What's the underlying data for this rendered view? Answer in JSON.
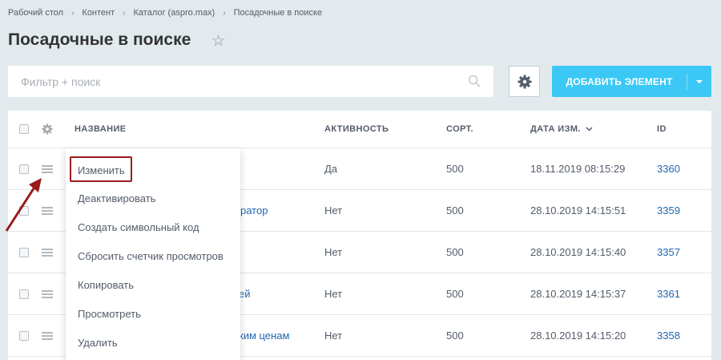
{
  "breadcrumb": [
    "Рабочий стол",
    "Контент",
    "Каталог (aspro.max)",
    "Посадочные в поиске"
  ],
  "page_title": "Посадочные в поиске",
  "filter": {
    "placeholder": "Фильтр + поиск"
  },
  "add_button_label": "ДОБАВИТЬ ЭЛЕМЕНТ",
  "columns": {
    "name": "НАЗВАНИЕ",
    "active": "АКТИВНОСТЬ",
    "sort": "СОРТ.",
    "date": "ДАТА ИЗМ.",
    "id": "ID"
  },
  "rows": [
    {
      "name": "",
      "active": "Да",
      "sort": "500",
      "date": "18.11.2019 08:15:29",
      "id": "3360"
    },
    {
      "name": "ратор",
      "active": "Нет",
      "sort": "500",
      "date": "28.10.2019 14:15:51",
      "id": "3359"
    },
    {
      "name": "",
      "active": "Нет",
      "sort": "500",
      "date": "28.10.2019 14:15:40",
      "id": "3357"
    },
    {
      "name": "ей",
      "active": "Нет",
      "sort": "500",
      "date": "28.10.2019 14:15:37",
      "id": "3361"
    },
    {
      "name": "ким ценам",
      "active": "Нет",
      "sort": "500",
      "date": "28.10.2019 14:15:20",
      "id": "3358"
    }
  ],
  "context_menu": [
    "Изменить",
    "Деактивировать",
    "Создать символьный код",
    "Сбросить счетчик просмотров",
    "Копировать",
    "Просмотреть",
    "Удалить"
  ],
  "colors": {
    "accent": "#3bc8f5",
    "link": "#2067b0",
    "highlight": "#9b1c1c",
    "background": "#e3eaed"
  }
}
